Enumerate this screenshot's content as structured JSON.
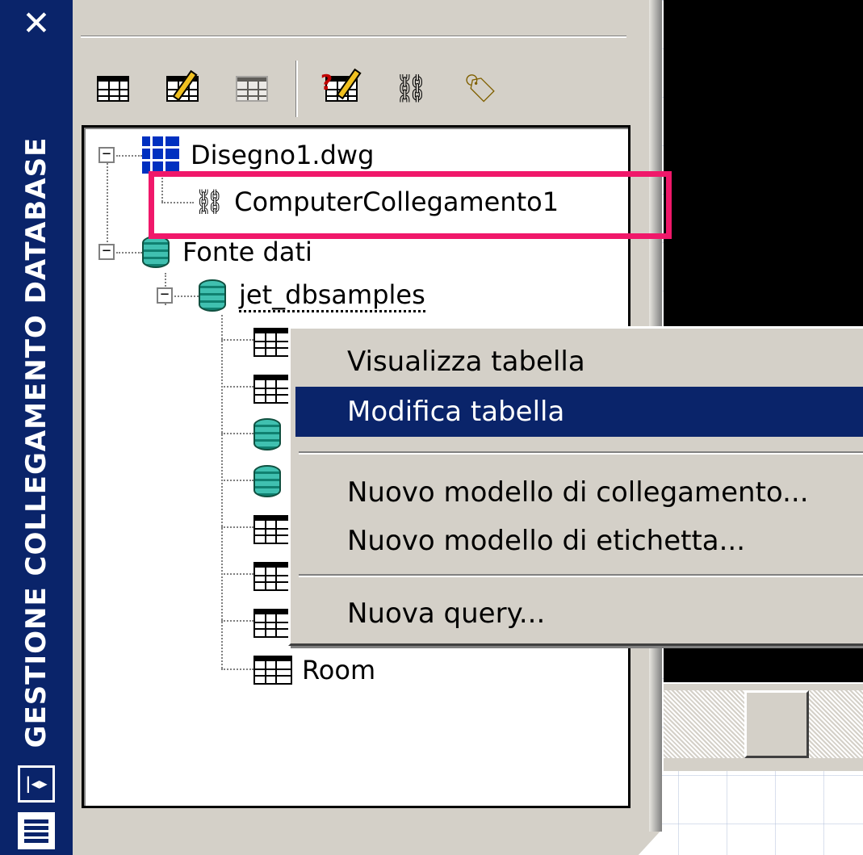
{
  "palette": {
    "title": "GESTIONE COLLEGAMENTO DATABASE",
    "close_glyph": "✕",
    "autohide_glyph": "|◂▸"
  },
  "toolbar": {
    "buttons": [
      {
        "name": "view-table-icon"
      },
      {
        "name": "edit-table-icon"
      },
      {
        "name": "execute-query-icon"
      },
      {
        "name": "new-query-icon"
      },
      {
        "name": "link-template-icon"
      },
      {
        "name": "label-template-icon"
      }
    ]
  },
  "tree": {
    "drawing": "Disegno1.dwg",
    "link_template": "ComputerCollegamento1",
    "data_sources": "Fonte dati",
    "database": "jet_dbsamples",
    "last_table": "Room"
  },
  "context_menu": {
    "items": [
      {
        "label": "Visualizza tabella",
        "active": false
      },
      {
        "label": "Modifica tabella",
        "active": true
      },
      {
        "label": "Nuovo modello di collegamento...",
        "active": false
      },
      {
        "label": "Nuovo modello di etichetta...",
        "active": false
      },
      {
        "label": "Nuova query...",
        "active": false
      }
    ]
  },
  "colors": {
    "titlebar": "#0a246a",
    "highlight_box": "#f0186a",
    "panel": "#d4d0c8",
    "selection": "#0a246a"
  }
}
